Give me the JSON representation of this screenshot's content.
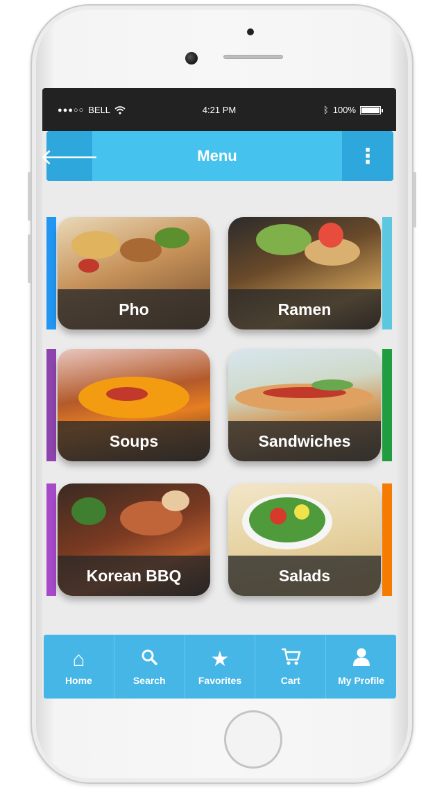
{
  "status_bar": {
    "signal": "●●●○○",
    "carrier": "BELL",
    "wifi_icon": "wifi-icon",
    "time": "4:21 PM",
    "bluetooth_icon": "bluetooth-icon",
    "battery_percent": "100%",
    "battery_level": 1.0
  },
  "header": {
    "back_icon": "arrow-left-icon",
    "title": "Menu",
    "more_icon": "more-vertical-icon"
  },
  "menu": {
    "items": [
      {
        "label": "Pho",
        "accent_color": "#2196f3"
      },
      {
        "label": "Ramen",
        "accent_color": "#5bc8e0"
      },
      {
        "label": "Soups",
        "accent_color": "#8e44ad"
      },
      {
        "label": "Sandwiches",
        "accent_color": "#1f9d3f"
      },
      {
        "label": "Korean BBQ",
        "accent_color": "#a64ac9"
      },
      {
        "label": "Salads",
        "accent_color": "#f57c00"
      }
    ]
  },
  "tab_bar": {
    "items": [
      {
        "label": "Home",
        "icon": "home-icon",
        "glyph": "⌂"
      },
      {
        "label": "Search",
        "icon": "search-icon",
        "glyph": "⚲"
      },
      {
        "label": "Favorites",
        "icon": "star-icon",
        "glyph": "★"
      },
      {
        "label": "Cart",
        "icon": "cart-icon",
        "glyph": "🛒"
      },
      {
        "label": "My Profile",
        "icon": "user-icon",
        "glyph": "👤"
      }
    ]
  },
  "colors": {
    "nav_bar": "#45c2ee",
    "nav_bar_dark": "#2ea8dc",
    "tab_bar": "#45b6e6",
    "status_bar": "#222222",
    "screen_bg": "#ebebeb"
  }
}
